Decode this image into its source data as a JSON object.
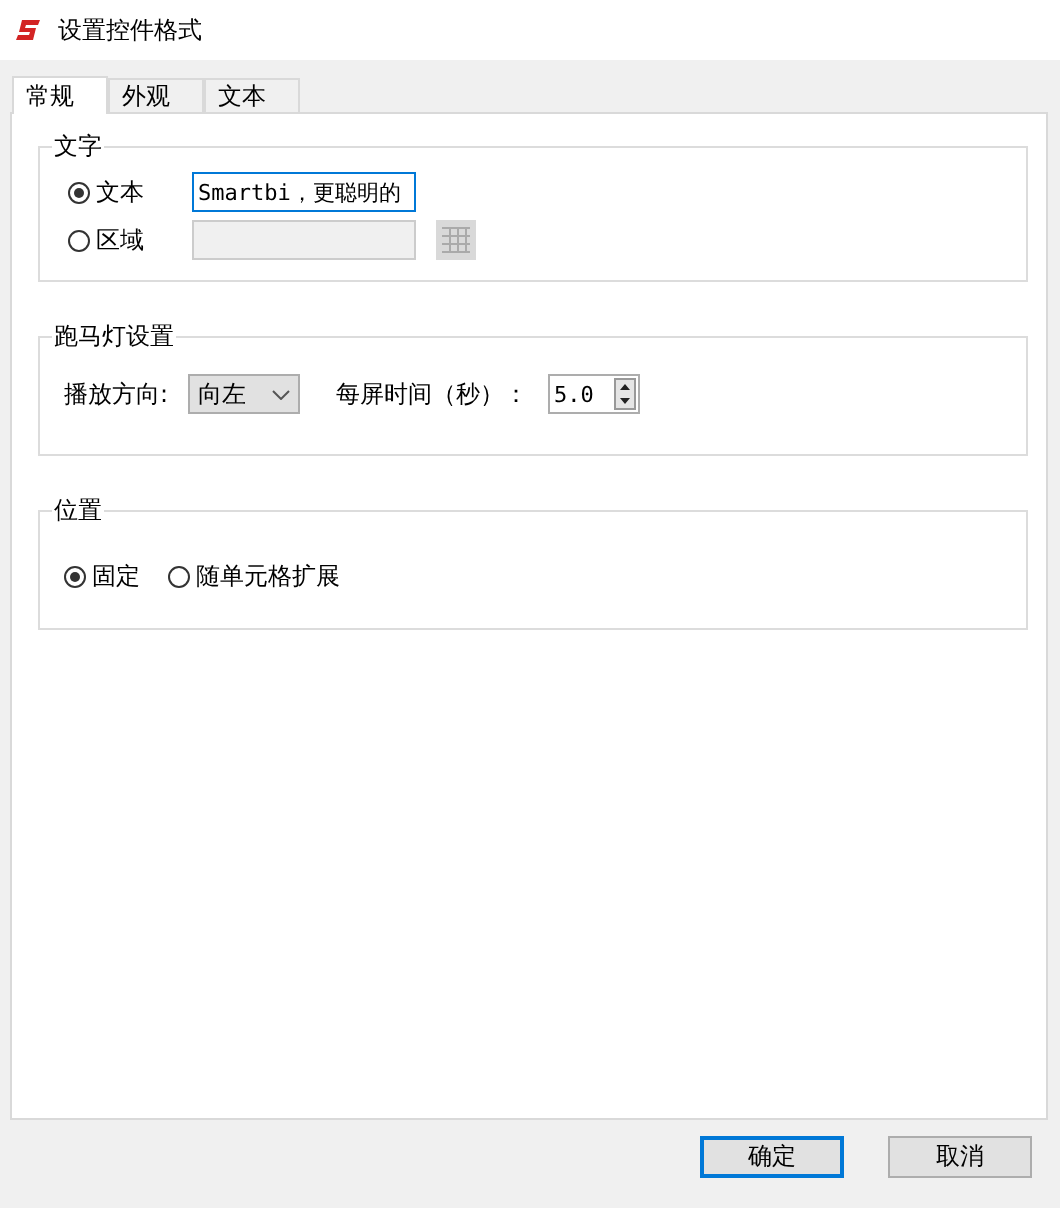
{
  "window": {
    "title": "设置控件格式"
  },
  "tabs": [
    {
      "label": "常规",
      "selected": true
    },
    {
      "label": "外观",
      "selected": false
    },
    {
      "label": "文本",
      "selected": false
    }
  ],
  "text_group": {
    "title": "文字",
    "options": [
      {
        "kind": "text",
        "label": "文本",
        "selected": true,
        "value": "Smartbi，更聪明的",
        "disabled": false
      },
      {
        "kind": "range",
        "label": "区域",
        "selected": false,
        "disabled": true
      }
    ]
  },
  "marquee": {
    "title": "跑马灯设置",
    "direction_label": "播放方向:",
    "direction": "向左",
    "time_label": "每屏时间（秒）：",
    "time": "5.0"
  },
  "position": {
    "title": "位置",
    "options": [
      {
        "label": "固定",
        "selected": true
      },
      {
        "label": "随单元格扩展",
        "selected": false
      }
    ]
  },
  "buttons": [
    {
      "label": "确定",
      "default": true
    },
    {
      "label": "取消",
      "default": false
    }
  ]
}
